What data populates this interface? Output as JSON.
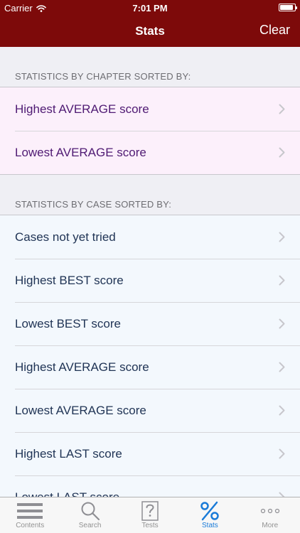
{
  "status": {
    "carrier": "Carrier",
    "time": "7:01 PM",
    "battery_level": 0.9
  },
  "nav": {
    "title": "Stats",
    "clear_label": "Clear"
  },
  "sections": {
    "chapter": {
      "header": "STATISTICS BY CHAPTER SORTED BY:",
      "items": [
        "Highest AVERAGE score",
        "Lowest AVERAGE score"
      ]
    },
    "case": {
      "header": "STATISTICS BY CASE SORTED BY:",
      "items": [
        "Cases not yet tried",
        "Highest BEST score",
        "Lowest BEST score",
        "Highest AVERAGE score",
        "Lowest AVERAGE score",
        "Highest LAST score",
        "Lowest LAST score"
      ]
    }
  },
  "tabs": [
    {
      "label": "Contents",
      "icon": "list-icon"
    },
    {
      "label": "Search",
      "icon": "magnifier-icon"
    },
    {
      "label": "Tests",
      "icon": "question-sheet-icon"
    },
    {
      "label": "Stats",
      "icon": "percent-icon",
      "active": true
    },
    {
      "label": "More",
      "icon": "more-dots-icon"
    }
  ],
  "colors": {
    "nav_bg": "#7d0a0a",
    "chapter_row_bg": "#fcf0fb",
    "chapter_text": "#4f1a73",
    "case_row_bg": "#f3f8fd",
    "case_text": "#1f3354",
    "tab_active": "#1a7bd8",
    "tab_inactive": "#929292"
  }
}
